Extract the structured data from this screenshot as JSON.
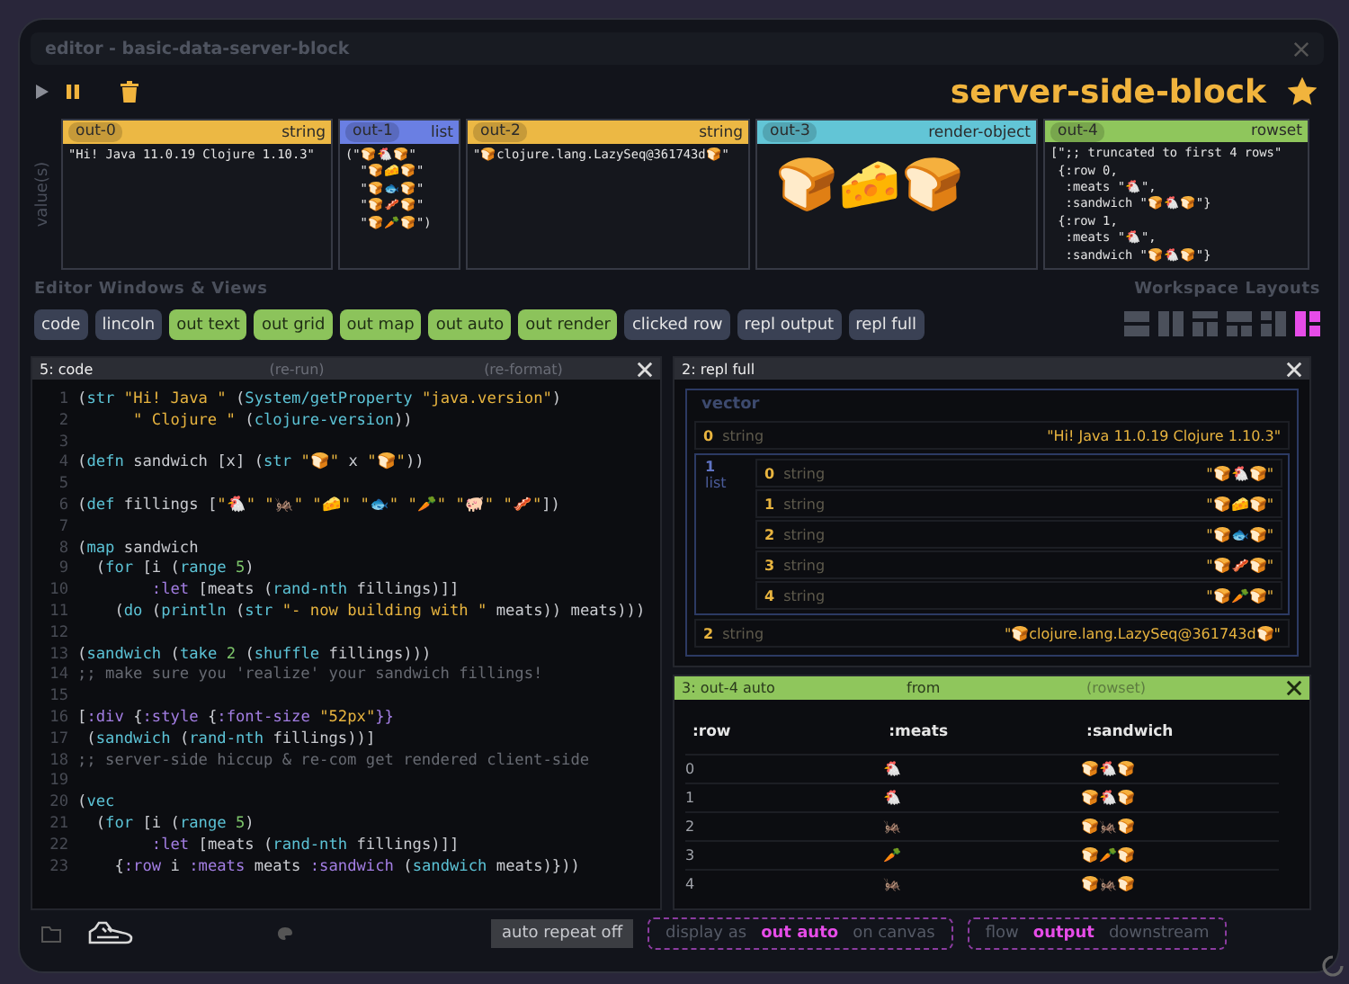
{
  "window": {
    "title": "editor - basic-data-server-block"
  },
  "toolbar": {
    "block_name": "server-side-block",
    "starred": true
  },
  "outputs": {
    "label": "value(s)",
    "cards": [
      {
        "id": "out-0",
        "type": "string",
        "kind": "text",
        "color": "#ecb844",
        "lines": [
          "\"Hi! Java 11.0.19 Clojure 1.10.3\""
        ]
      },
      {
        "id": "out-1",
        "type": "list",
        "kind": "text",
        "color": "#6a7fe3",
        "lines": [
          "(\"🍞🐔🍞\"",
          "  \"🍞🧀🍞\"",
          "  \"🍞🐟🍞\"",
          "  \"🍞🥓🍞\"",
          "  \"🍞🥕🍞\")"
        ]
      },
      {
        "id": "out-2",
        "type": "string",
        "kind": "text",
        "color": "#ecb844",
        "lines": [
          "\"🍞clojure.lang.LazySeq@361743d🍞\""
        ]
      },
      {
        "id": "out-3",
        "type": "render-object",
        "kind": "render",
        "color": "#62c5d6",
        "content": "🍞🧀🍞"
      },
      {
        "id": "out-4",
        "type": "rowset",
        "kind": "text",
        "color": "#8fc65c",
        "lines": [
          "[\";; truncated to first 4 rows\"",
          " {:row 0,",
          "  :meats \"🐔\",",
          "  :sandwich \"🍞🐔🍞\"}",
          " {:row 1,",
          "  :meats \"🐔\",",
          "  :sandwich \"🍞🐔🍞\"}"
        ]
      }
    ]
  },
  "views": {
    "title": "Editor Windows & Views",
    "chips": [
      {
        "label": "code",
        "on": false
      },
      {
        "label": "lincoln",
        "on": false
      },
      {
        "label": "out text",
        "on": true
      },
      {
        "label": "out grid",
        "on": true
      },
      {
        "label": "out map",
        "on": true
      },
      {
        "label": "out auto",
        "on": true
      },
      {
        "label": "out render",
        "on": true
      },
      {
        "label": "clicked row",
        "on": false
      },
      {
        "label": "repl output",
        "on": false
      },
      {
        "label": "repl full",
        "on": false
      }
    ]
  },
  "layouts": {
    "title": "Workspace Layouts",
    "items": [
      {
        "selected": false
      },
      {
        "selected": false
      },
      {
        "selected": false
      },
      {
        "selected": false
      },
      {
        "selected": false
      },
      {
        "selected": true
      }
    ]
  },
  "code_panel": {
    "title": "5: code",
    "actions": [
      "(re-run)",
      "(re-format)"
    ],
    "lines": [
      {
        "num": "1",
        "tokens": [
          {
            "text": "(",
            "kind": "p"
          },
          {
            "text": "str",
            "kind": "f"
          },
          {
            "text": " \"Hi! Java \"",
            "kind": "s"
          },
          {
            "text": " (",
            "kind": "p"
          },
          {
            "text": "System/getProperty",
            "kind": "f"
          },
          {
            "text": " \"java.version\"",
            "kind": "s"
          },
          {
            "text": ")",
            "kind": "p"
          }
        ]
      },
      {
        "num": "2",
        "tokens": [
          {
            "text": "      \" Clojure \"",
            "kind": "s"
          },
          {
            "text": " (",
            "kind": "p"
          },
          {
            "text": "clojure-version",
            "kind": "f"
          },
          {
            "text": "))",
            "kind": "p"
          }
        ]
      },
      {
        "num": "3"
      },
      {
        "num": "4",
        "tokens": [
          {
            "text": "(",
            "kind": "p"
          },
          {
            "text": "defn",
            "kind": "f"
          },
          {
            "text": " sandwich [x] (",
            "kind": "p"
          },
          {
            "text": "str",
            "kind": "f"
          },
          {
            "text": " \"🍞\"",
            "kind": "s"
          },
          {
            "text": " x ",
            "kind": "p"
          },
          {
            "text": "\"🍞\"",
            "kind": "s"
          },
          {
            "text": "))",
            "kind": "p"
          }
        ]
      },
      {
        "num": "5"
      },
      {
        "num": "6",
        "tokens": [
          {
            "text": "(",
            "kind": "p"
          },
          {
            "text": "def",
            "kind": "f"
          },
          {
            "text": " fillings [",
            "kind": "p"
          },
          {
            "text": "\"🐔\" \"🦗\" \"🧀\" \"🐟\" \"🥕\" \"🐖\" \"🥓\"",
            "kind": "s"
          },
          {
            "text": "])",
            "kind": "p"
          }
        ]
      },
      {
        "num": "7"
      },
      {
        "num": "8",
        "tokens": [
          {
            "text": "(",
            "kind": "p"
          },
          {
            "text": "map",
            "kind": "f"
          },
          {
            "text": " sandwich",
            "kind": "p"
          }
        ]
      },
      {
        "num": "9",
        "tokens": [
          {
            "text": "  (",
            "kind": "p"
          },
          {
            "text": "for",
            "kind": "f"
          },
          {
            "text": " [i (",
            "kind": "p"
          },
          {
            "text": "range",
            "kind": "f"
          },
          {
            "text": " 5",
            "kind": "n"
          },
          {
            "text": ")",
            "kind": "p"
          }
        ]
      },
      {
        "num": "10",
        "tokens": [
          {
            "text": "        :let",
            "kind": "k"
          },
          {
            "text": " [meats (",
            "kind": "p"
          },
          {
            "text": "rand-nth",
            "kind": "f"
          },
          {
            "text": " fillings)]]",
            "kind": "p"
          }
        ]
      },
      {
        "num": "11",
        "tokens": [
          {
            "text": "    (",
            "kind": "p"
          },
          {
            "text": "do",
            "kind": "f"
          },
          {
            "text": " (",
            "kind": "p"
          },
          {
            "text": "println",
            "kind": "f"
          },
          {
            "text": " (",
            "kind": "p"
          },
          {
            "text": "str",
            "kind": "f"
          },
          {
            "text": " \"- now building with \"",
            "kind": "s"
          },
          {
            "text": " meats)) meats)))",
            "kind": "p"
          }
        ]
      },
      {
        "num": "12"
      },
      {
        "num": "13",
        "tokens": [
          {
            "text": "(",
            "kind": "p"
          },
          {
            "text": "sandwich",
            "kind": "f"
          },
          {
            "text": " (",
            "kind": "p"
          },
          {
            "text": "take",
            "kind": "f"
          },
          {
            "text": " 2",
            "kind": "n"
          },
          {
            "text": " (",
            "kind": "p"
          },
          {
            "text": "shuffle",
            "kind": "f"
          },
          {
            "text": " fillings)))",
            "kind": "p"
          }
        ]
      },
      {
        "num": "14",
        "tokens": [
          {
            "text": ";; make sure you 'realize' your sandwich fillings!",
            "kind": "c"
          }
        ]
      },
      {
        "num": "15"
      },
      {
        "num": "16",
        "tokens": [
          {
            "text": "[",
            "kind": "p"
          },
          {
            "text": ":div",
            "kind": "k"
          },
          {
            "text": " {",
            "kind": "p"
          },
          {
            "text": ":style",
            "kind": "k"
          },
          {
            "text": " {",
            "kind": "p"
          },
          {
            "text": ":font-size",
            "kind": "k"
          },
          {
            "text": " \"52px\"",
            "kind": "s"
          },
          {
            "text": "}}",
            "kind": "k"
          }
        ]
      },
      {
        "num": "17",
        "tokens": [
          {
            "text": " (",
            "kind": "p"
          },
          {
            "text": "sandwich",
            "kind": "f"
          },
          {
            "text": " (",
            "kind": "p"
          },
          {
            "text": "rand-nth",
            "kind": "f"
          },
          {
            "text": " fillings))]",
            "kind": "p"
          }
        ]
      },
      {
        "num": "18",
        "tokens": [
          {
            "text": ";; server-side hiccup & re-com get rendered client-side",
            "kind": "c"
          }
        ]
      },
      {
        "num": "19"
      },
      {
        "num": "20",
        "tokens": [
          {
            "text": "(",
            "kind": "p"
          },
          {
            "text": "vec",
            "kind": "f"
          }
        ]
      },
      {
        "num": "21",
        "tokens": [
          {
            "text": "  (",
            "kind": "p"
          },
          {
            "text": "for",
            "kind": "f"
          },
          {
            "text": " [i (",
            "kind": "p"
          },
          {
            "text": "range",
            "kind": "f"
          },
          {
            "text": " 5",
            "kind": "n"
          },
          {
            "text": ")",
            "kind": "p"
          }
        ]
      },
      {
        "num": "22",
        "tokens": [
          {
            "text": "        :let",
            "kind": "k"
          },
          {
            "text": " [meats (",
            "kind": "p"
          },
          {
            "text": "rand-nth",
            "kind": "f"
          },
          {
            "text": " fillings)]]",
            "kind": "p"
          }
        ]
      },
      {
        "num": "23",
        "tokens": [
          {
            "text": "    {",
            "kind": "p"
          },
          {
            "text": ":row",
            "kind": "k"
          },
          {
            "text": " i ",
            "kind": "p"
          },
          {
            "text": ":meats",
            "kind": "k"
          },
          {
            "text": " meats ",
            "kind": "p"
          },
          {
            "text": ":sandwich",
            "kind": "k"
          },
          {
            "text": " (",
            "kind": "p"
          },
          {
            "text": "sandwich",
            "kind": "f"
          },
          {
            "text": " meats)}))",
            "kind": "p"
          }
        ]
      }
    ]
  },
  "repl_panel": {
    "title": "2: repl full",
    "root_type": "vector",
    "items": [
      {
        "index": "0",
        "type": "string",
        "value": "\"Hi! Java 11.0.19 Clojure 1.10.3\""
      },
      {
        "index": "1",
        "type": "list",
        "children": [
          {
            "index": "0",
            "type": "string",
            "value": "\"🍞🐔🍞\""
          },
          {
            "index": "1",
            "type": "string",
            "value": "\"🍞🧀🍞\""
          },
          {
            "index": "2",
            "type": "string",
            "value": "\"🍞🐟🍞\""
          },
          {
            "index": "3",
            "type": "string",
            "value": "\"🍞🥓🍞\""
          },
          {
            "index": "4",
            "type": "string",
            "value": "\"🍞🥕🍞\""
          }
        ]
      },
      {
        "index": "2",
        "type": "string",
        "value": "\"🍞clojure.lang.LazySeq@361743d🍞\""
      }
    ]
  },
  "table_panel": {
    "title": "3: out-4 auto",
    "from": "from",
    "source": "(rowset)",
    "columns": [
      ":row",
      ":meats",
      ":sandwich"
    ],
    "rows": [
      [
        "0",
        "🐔",
        "🍞🐔🍞"
      ],
      [
        "1",
        "🐔",
        "🍞🐔🍞"
      ],
      [
        "2",
        "🦗",
        "🍞🦗🍞"
      ],
      [
        "3",
        "🥕",
        "🍞🥕🍞"
      ],
      [
        "4",
        "🦗",
        "🍞🦗🍞"
      ]
    ]
  },
  "bottom_bar": {
    "repeat_button": "auto repeat off",
    "display": {
      "prefix": "display as",
      "value": "out auto",
      "suffix": "on canvas"
    },
    "flow": {
      "prefix": "flow",
      "value": "output",
      "suffix": "downstream"
    }
  }
}
